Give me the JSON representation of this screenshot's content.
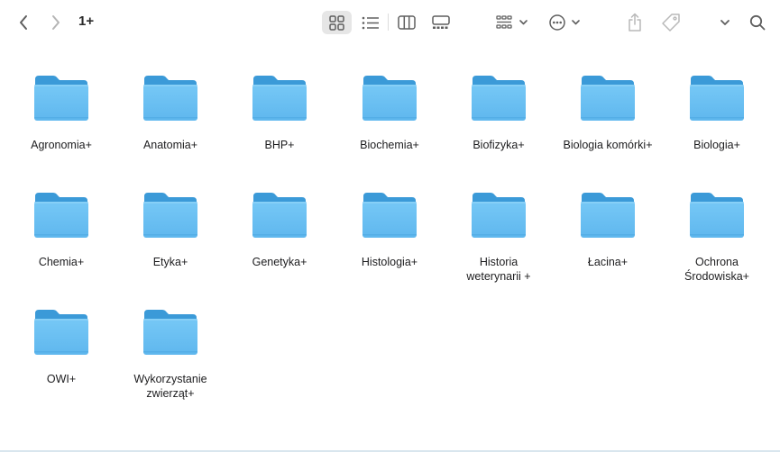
{
  "toolbar": {
    "title": "1+",
    "icons": [
      "chevron-left-icon",
      "chevron-right-icon",
      "grid-view-icon",
      "list-view-icon",
      "column-view-icon",
      "gallery-view-icon",
      "group-icon",
      "ellipsis-circle-icon",
      "share-icon",
      "tag-icon",
      "chevron-down-icon",
      "search-icon"
    ]
  },
  "folders": [
    {
      "label": "Agronomia+"
    },
    {
      "label": "Anatomia+"
    },
    {
      "label": "BHP+"
    },
    {
      "label": "Biochemia+"
    },
    {
      "label": "Biofizyka+"
    },
    {
      "label": "Biologia komórki+"
    },
    {
      "label": "Biologia+"
    },
    {
      "label": "Chemia+"
    },
    {
      "label": "Etyka+"
    },
    {
      "label": "Genetyka+"
    },
    {
      "label": "Histologia+"
    },
    {
      "label": "Historia\nweterynarii +"
    },
    {
      "label": "Łacina+"
    },
    {
      "label": "Ochrona\nŚrodowiska+"
    },
    {
      "label": "OWI+"
    },
    {
      "label": "Wykorzystanie\nzwierząt+"
    }
  ],
  "colors": {
    "folder_body": "#6cc2f4",
    "folder_tab": "#3b9ad8",
    "toolbar_icon": "#5f5f5f",
    "active_view_bg": "#e6e6e6"
  }
}
